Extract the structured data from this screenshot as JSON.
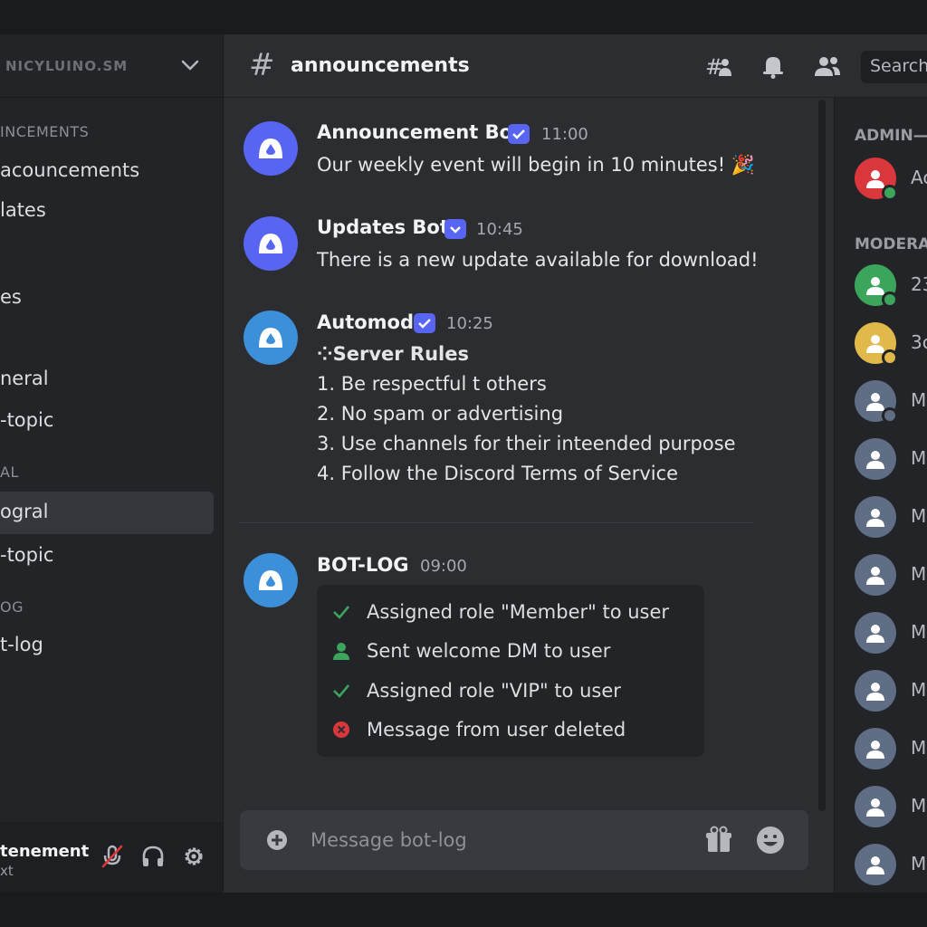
{
  "server": {
    "name": "NICYLUINO.SM"
  },
  "sidebar": {
    "categories": [
      "INCEMENTS",
      "AL",
      "OG"
    ],
    "channels": [
      "acouncements",
      "lates",
      "es",
      "neral",
      "-topic",
      "ogral",
      "-topic",
      "t-log"
    ]
  },
  "user_panel": {
    "name": "tenement",
    "status": "xt"
  },
  "channel": {
    "name": "announcements",
    "hash": "#"
  },
  "header": {
    "search_label": "Search"
  },
  "messages": [
    {
      "author": "Announcement Bot",
      "time": "11:00",
      "lines": [
        "Our weekly event will begin in 10 minutes! 🎉"
      ]
    },
    {
      "author": "Updates Bot",
      "time": "10:45",
      "lines": [
        "There is a new update available for download!"
      ]
    },
    {
      "author": "Automod",
      "time": "10:25",
      "lines": [
        "⁘Server Rules",
        "1. Be respectful t others",
        "2. No spam or advertising",
        "3. Use channels for their inteended purpose",
        "4. Follow the Discord Terms of Service"
      ]
    },
    {
      "author": "BOT-LOG",
      "time": "09:00",
      "lines": []
    }
  ],
  "bot_log": [
    {
      "icon": "check-icon",
      "text": "Assigned role \"Member\" to user",
      "color": "#3ba55c"
    },
    {
      "icon": "user-icon",
      "text": "Sent welcome DM to user",
      "color": "#3ba55c"
    },
    {
      "icon": "check-icon",
      "text": "Assigned role \"VIP\" to user",
      "color": "#3ba55c"
    },
    {
      "icon": "x-circle-icon",
      "text": "Message from user deleted",
      "color": "#da373c"
    }
  ],
  "composer": {
    "placeholder": "Message bot-log"
  },
  "members": {
    "categories": [
      "ADMIN—T",
      "MODERA"
    ],
    "items": [
      {
        "name": "Ac",
        "color": "#da373c",
        "status": "#3ba55c"
      },
      {
        "name": "23",
        "color": "#3ba55c",
        "status": "#3ba55c"
      },
      {
        "name": "3c",
        "color": "#e0b94a",
        "status": "#e0b94a"
      },
      {
        "name": "M",
        "color": "#5f6e85",
        "status": "#5f6e85"
      },
      {
        "name": "M",
        "color": "#5f6e85",
        "status": ""
      },
      {
        "name": "M",
        "color": "#5f6e85",
        "status": ""
      },
      {
        "name": "M",
        "color": "#5f6e85",
        "status": ""
      },
      {
        "name": "M",
        "color": "#5f6e85",
        "status": ""
      },
      {
        "name": "M",
        "color": "#5f6e85",
        "status": ""
      },
      {
        "name": "M",
        "color": "#5f6e85",
        "status": ""
      },
      {
        "name": "M",
        "color": "#5f6e85",
        "status": ""
      },
      {
        "name": "M",
        "color": "#5f6e85",
        "status": ""
      }
    ]
  },
  "colors": {
    "accent": "#5865f2",
    "bot_avatar": "#5865f2",
    "bot_avatar_alt": "#3c8fd9"
  }
}
